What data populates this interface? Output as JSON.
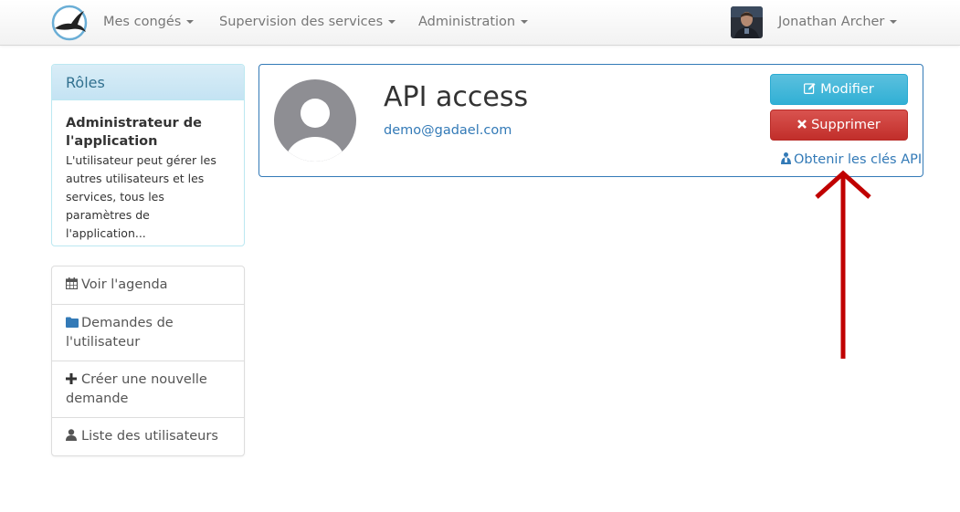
{
  "navbar": {
    "menu_leaves": "Mes congés",
    "menu_supervision": "Supervision des services",
    "menu_admin": "Administration",
    "user_name": "Jonathan Archer"
  },
  "roles": {
    "heading": "Rôles",
    "title": "Administrateur de l'application",
    "description": "L'utilisateur peut gérer les autres utilisateurs et les services, tous les paramètres de l'application..."
  },
  "actions": {
    "agenda": "Voir l'agenda",
    "user_requests": "Demandes de l'utilisateur",
    "new_request": "Créer une nouvelle demande",
    "user_list": "Liste des utilisateurs"
  },
  "profile": {
    "name": "API access",
    "email": "demo@gadael.com",
    "edit_label": "Modifier",
    "delete_label": "Supprimer",
    "api_keys_label": "Obtenir les clés API"
  },
  "colors": {
    "link": "#337ab7",
    "info": "#5bc0de",
    "danger": "#d9534f",
    "annotation_arrow": "#c00000"
  }
}
